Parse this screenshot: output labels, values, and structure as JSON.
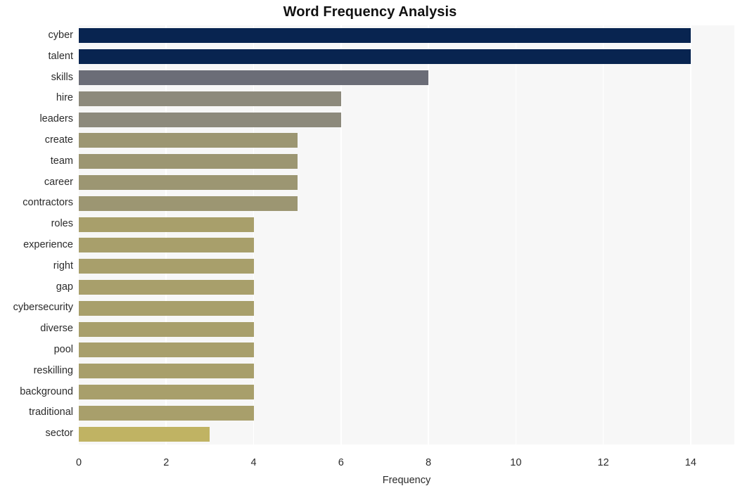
{
  "chart_data": {
    "type": "bar",
    "orientation": "horizontal",
    "title": "Word Frequency Analysis",
    "xlabel": "Frequency",
    "ylabel": "",
    "xlim": [
      0,
      15
    ],
    "xticks": [
      0,
      2,
      4,
      6,
      8,
      10,
      12,
      14
    ],
    "xtick_labels": [
      "0",
      "2",
      "4",
      "6",
      "8",
      "10",
      "12",
      "14"
    ],
    "grid": "vertical-white-on-gray",
    "legend": "none",
    "categories": [
      "cyber",
      "talent",
      "skills",
      "hire",
      "leaders",
      "create",
      "team",
      "career",
      "contractors",
      "roles",
      "experience",
      "right",
      "gap",
      "cybersecurity",
      "diverse",
      "pool",
      "reskilling",
      "background",
      "traditional",
      "sector"
    ],
    "values": [
      14,
      14,
      8,
      6,
      6,
      5,
      5,
      5,
      5,
      4,
      4,
      4,
      4,
      4,
      4,
      4,
      4,
      4,
      4,
      3
    ],
    "bar_colors": [
      "#082450",
      "#082450",
      "#6b6d77",
      "#8d8a7c",
      "#8d8a7c",
      "#9c9672",
      "#9c9672",
      "#9c9672",
      "#9c9672",
      "#a89f6b",
      "#a89f6b",
      "#a89f6b",
      "#a89f6b",
      "#a89f6b",
      "#a89f6b",
      "#a89f6b",
      "#a89f6b",
      "#a89f6b",
      "#a89f6b",
      "#c0b363"
    ],
    "plot_background": "#f7f7f7",
    "figure_background": "#ffffff",
    "gridline_color": "#ffffff"
  }
}
